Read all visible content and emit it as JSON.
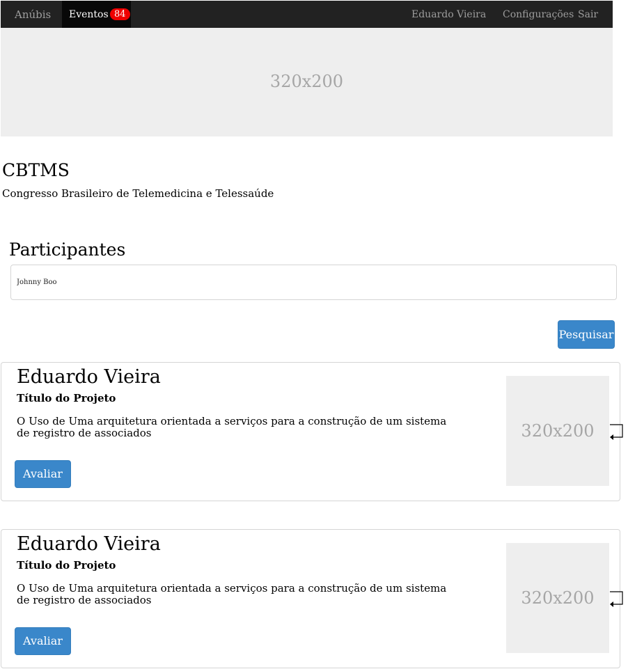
{
  "navbar": {
    "brand": "Anúbis",
    "active_tab": {
      "label": "Eventos",
      "badge": "84"
    },
    "user_name": "Eduardo Vieira",
    "settings": "Configurações",
    "logout": "Sair"
  },
  "hero": {
    "placeholder": "320x200"
  },
  "event": {
    "title": "CBTMS",
    "subtitle": "Congresso Brasileiro de Telemedicina e Telessaúde"
  },
  "participants": {
    "title": "Participantes",
    "search_value": "Johnny Boo",
    "search_button": "Pesquisar"
  },
  "cards": [
    {
      "name": "Eduardo Vieira",
      "project_label": "Título do Projeto",
      "description": "O Uso de Uma arquitetura orientada a serviços para a construção de um sistema de registro de associados",
      "button": "Avaliar",
      "thumb": "320x200"
    },
    {
      "name": "Eduardo Vieira",
      "project_label": "Título do Projeto",
      "description": "O Uso de Uma arquitetura orientada a serviços para a construção de um sistema de registro de associados",
      "button": "Avaliar",
      "thumb": "320x200"
    }
  ]
}
